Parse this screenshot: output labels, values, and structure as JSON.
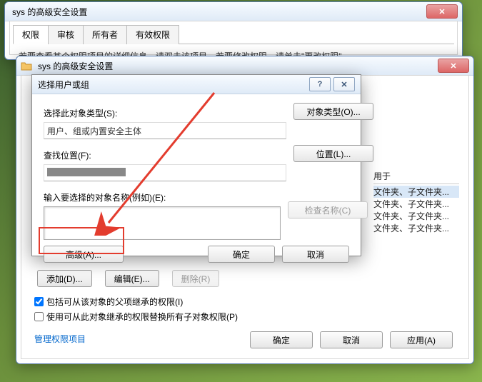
{
  "win1": {
    "title": "sys 的高级安全设置",
    "tabs": [
      "权限",
      "审核",
      "所有者",
      "有效权限"
    ],
    "trunc_line": "若要查看某个权限项目的详细信息，请双击该项目。若要修改权限，请单击\"更改权限\"。"
  },
  "win2": {
    "title": "sys 的高级安全设置",
    "side_label": "用于",
    "list_items": [
      "文件夹、子文件夹...",
      "文件夹、子文件夹...",
      "文件夹、子文件夹...",
      "文件夹、子文件夹..."
    ],
    "btn_add": "添加(D)...",
    "btn_edit": "编辑(E)...",
    "btn_remove": "删除(R)",
    "chk1": "包括可从该对象的父项继承的权限(I)",
    "chk2": "使用可从此对象继承的权限替换所有子对象权限(P)",
    "link": "管理权限项目",
    "ok": "确定",
    "cancel": "取消",
    "apply": "应用(A)"
  },
  "modal": {
    "title": "选择用户或组",
    "lbl_type": "选择此对象类型(S):",
    "val_type": "用户、组或内置安全主体",
    "btn_type": "对象类型(O)...",
    "lbl_loc": "查找位置(F):",
    "btn_loc": "位置(L)...",
    "lbl_name": "输入要选择的对象名称(例如)(E):",
    "btn_check": "检查名称(C)",
    "btn_adv": "高级(A)...",
    "ok": "确定",
    "cancel": "取消"
  }
}
